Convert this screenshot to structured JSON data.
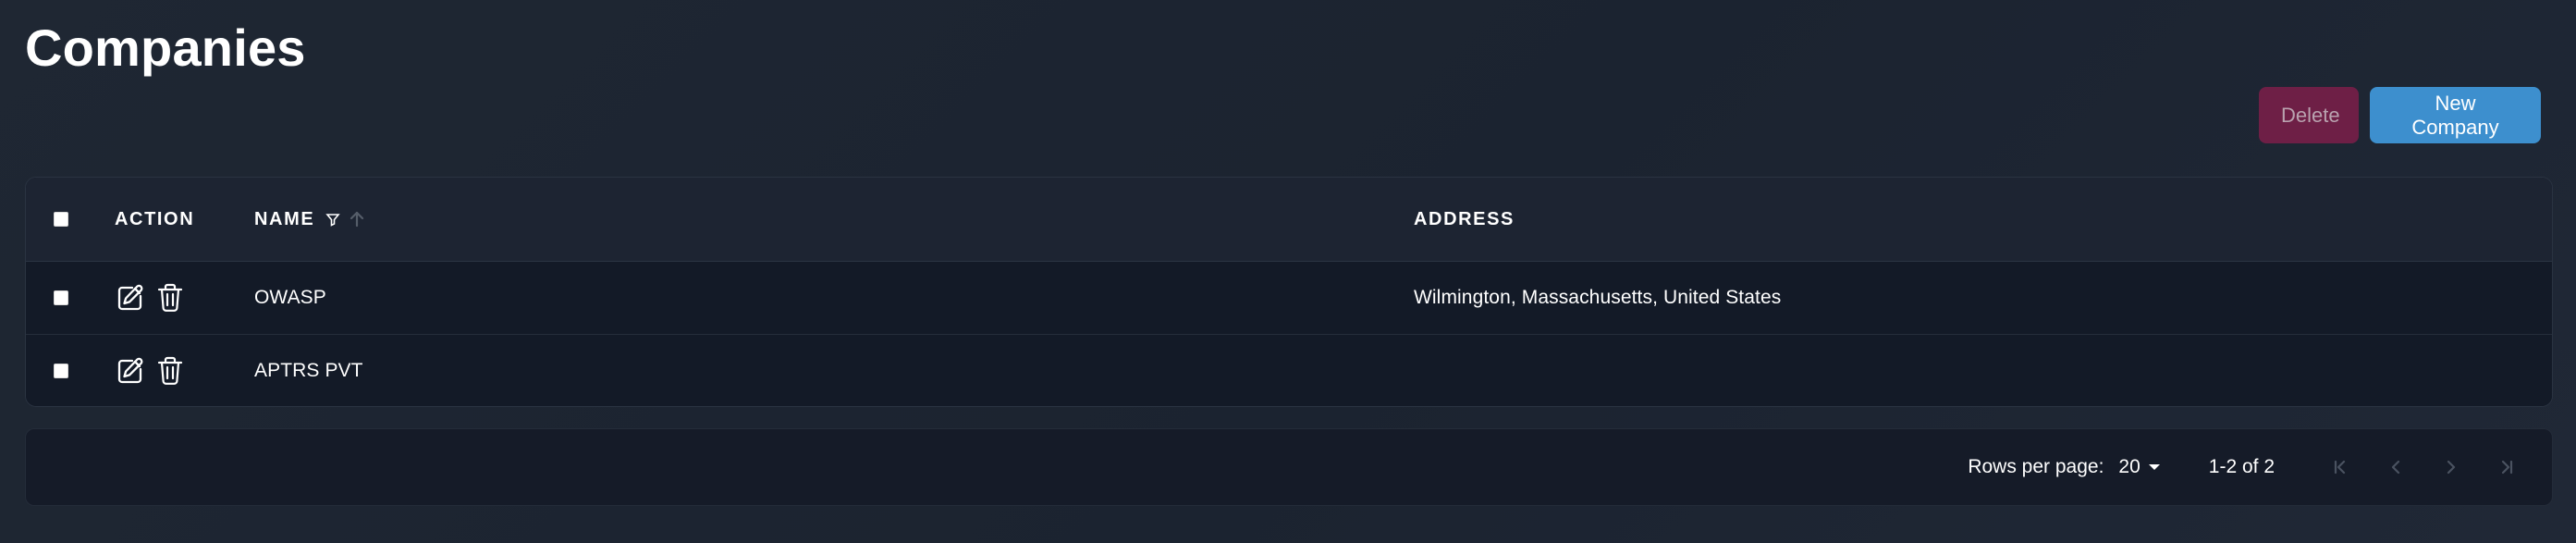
{
  "page": {
    "title": "Companies"
  },
  "toolbar": {
    "delete_label": "Delete",
    "new_company_label": "New Company",
    "colors": {
      "delete_bg": "#6e1f46",
      "new_bg": "#3d8fce"
    }
  },
  "table": {
    "headers": {
      "action": "ACTION",
      "name": "NAME",
      "address": "ADDRESS"
    },
    "header_icons": [
      "select-all-checkbox",
      "filter-icon",
      "sort-up-icon"
    ],
    "rows": [
      {
        "name": "OWASP",
        "address": "Wilmington, Massachusetts, United States",
        "actions": [
          "edit-icon",
          "trash-icon"
        ]
      },
      {
        "name": "APTRS PVT",
        "address": "",
        "actions": [
          "edit-icon",
          "trash-icon"
        ]
      }
    ]
  },
  "pagination": {
    "rows_per_page_label": "Rows per page:",
    "rows_per_page_value": "20",
    "range_text": "1-2 of 2",
    "nav_icons": [
      "first-page-icon",
      "previous-page-icon",
      "next-page-icon",
      "last-page-icon"
    ]
  }
}
